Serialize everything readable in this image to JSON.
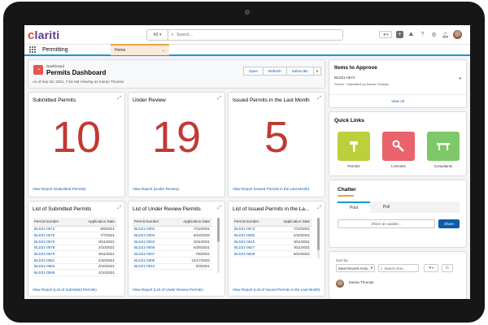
{
  "header": {
    "logo_mark": "c",
    "logo_rest": "lariti",
    "search_scope": "All",
    "search_placeholder": "Search..."
  },
  "nav": {
    "app_name": "Permitting",
    "tab_label": "Home"
  },
  "page": {
    "breadcrumb": "Dashboard",
    "title": "Permits Dashboard",
    "subtitle": "As of Sep 28, 2021, 7:53 AM·Viewing as Kieran Thomas",
    "buttons": [
      "Open",
      "Refresh",
      "Subscribe"
    ]
  },
  "metrics": [
    {
      "title": "Submitted Permits",
      "value": "10",
      "link": "View Report (Submitted Permits)"
    },
    {
      "title": "Under Review",
      "value": "19",
      "link": "View Report (Under Review)"
    },
    {
      "title": "Issued Permits in the Last Month",
      "value": "5",
      "link": "View Report (Issued Permits in the Last Month)"
    }
  ],
  "lists": [
    {
      "title": "List of Submitted Permits",
      "col1": "Permit Number",
      "col2": "Application Date",
      "rows": [
        [
          "BLD21-0573",
          "5/5/2021"
        ],
        [
          "BLD21-0575",
          "7/7/2021"
        ],
        [
          "BLD21-0576",
          "8/11/2021"
        ],
        [
          "BLD21-0578",
          "2/10/2021"
        ],
        [
          "BLD21-0579",
          "8/11/2021"
        ],
        [
          "BLD21-0581",
          "2/10/2021"
        ],
        [
          "BLD21-0583",
          "2/10/2021"
        ],
        [
          "BLD21-0585",
          "2/10/2021"
        ]
      ],
      "link": "View Report (List of Submitted Permits)"
    },
    {
      "title": "List of Under Review Permits",
      "col1": "Permit Number",
      "col2": "Application Date",
      "rows": [
        [
          "BLD21-0002",
          "7/12/2021"
        ],
        [
          "BLD21-0003",
          "6/22/2020"
        ],
        [
          "BLD21-0004",
          "6/11/2021"
        ],
        [
          "BLD21-0006",
          "6/25/2021"
        ],
        [
          "BLD21-0007",
          "7/6/2021"
        ],
        [
          "BLD21-0008",
          "12/17/2020"
        ],
        [
          "BLD21-0010",
          "2/3/2021"
        ]
      ],
      "link": "View Report (List of Under Review Permits)"
    },
    {
      "title": "List of Issued Permits in the La...",
      "col1": "Permit Number",
      "col2": "Application Date",
      "rows": [
        [
          "BLD21-0573",
          "7/12/2021"
        ],
        [
          "BLD21-0582",
          "2/10/2021"
        ],
        [
          "BLD21-0615",
          "8/11/2021"
        ],
        [
          "BLD21-0627",
          "8/11/2021"
        ],
        [
          "BLD21-0648",
          "9/24/2021"
        ]
      ],
      "link": "View Report (List of Issued Permits in the Last Month)"
    }
  ],
  "approve": {
    "title": "Items to Approve",
    "record": "BLD21-0574",
    "meta": "Permit · Submitted by Kieran Thomas",
    "view_all": "View All"
  },
  "quick_links": {
    "title": "Quick Links",
    "items": [
      {
        "label": "Permits",
        "color": "#bccf3c",
        "icon": "hammer-icon"
      },
      {
        "label": "Licenses",
        "color": "#e8636c",
        "icon": "wrench-icon"
      },
      {
        "label": "Complaints",
        "color": "#7ec86a",
        "icon": "bench-icon"
      }
    ]
  },
  "chatter": {
    "title": "Chatter",
    "tabs": [
      "Post",
      "Poll"
    ],
    "share_placeholder": "Share an update...",
    "share_button": "Share"
  },
  "feed": {
    "sort_label": "Sort by:",
    "sort_value": "Most Recent Activ...",
    "search_placeholder": "Search this...",
    "user_name": "Kieran Thomas"
  },
  "colors": {
    "accent": "#1b96d5",
    "metric_value": "#c23934",
    "link": "#0b5cab"
  }
}
